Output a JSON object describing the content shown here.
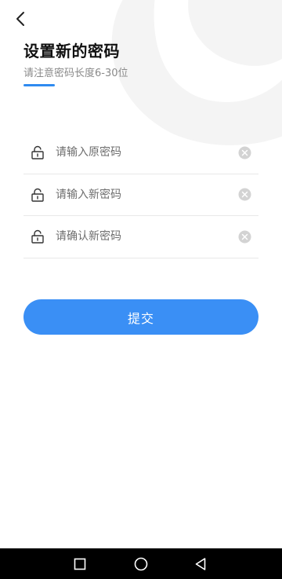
{
  "header": {
    "back_icon": "chevron-left-icon",
    "title": "设置新的密码",
    "subtitle": "请注意密码长度6-30位"
  },
  "form": {
    "fields": [
      {
        "placeholder": "请输入原密码",
        "value": "",
        "icon": "lock-icon",
        "clear_icon": "clear-circle-icon"
      },
      {
        "placeholder": "请输入新密码",
        "value": "",
        "icon": "lock-icon",
        "clear_icon": "clear-circle-icon"
      },
      {
        "placeholder": "请确认新密码",
        "value": "",
        "icon": "lock-icon",
        "clear_icon": "clear-circle-icon"
      }
    ],
    "submit_label": "提交"
  },
  "nav": {
    "recent_icon": "square-icon",
    "home_icon": "circle-icon",
    "back_icon": "triangle-back-icon"
  },
  "colors": {
    "accent": "#3a8ff5",
    "underline": "#2f8bf0",
    "title": "#111111",
    "subtitle": "#8a8a8a",
    "divider": "#e8e8e8",
    "watermark": "#f4f4f4",
    "nav_bar": "#000000"
  }
}
